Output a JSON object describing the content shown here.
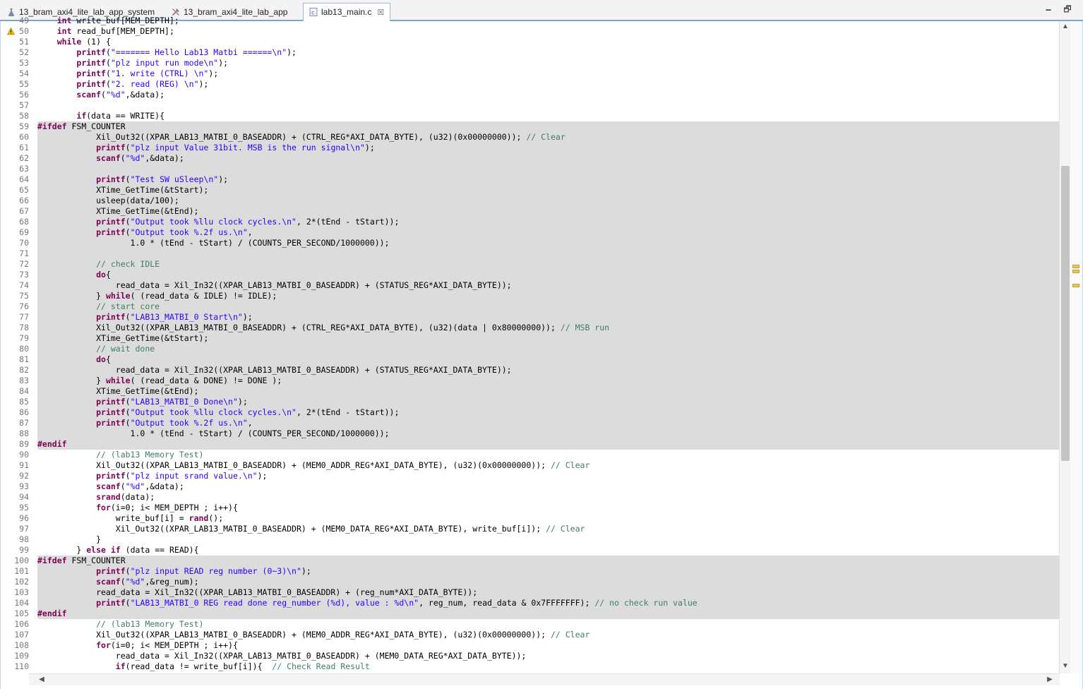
{
  "tabs": [
    {
      "label": "13_bram_axi4_lite_lab_app_system",
      "icon": "flask-icon"
    },
    {
      "label": "13_bram_axi4_lite_lab_app",
      "icon": "tools-icon"
    },
    {
      "label": "lab13_main.c",
      "icon": "c-file-icon",
      "active": true,
      "close": "☒"
    }
  ],
  "window_buttons": {
    "minimize": "🗕",
    "maximize": "🗗"
  },
  "code": {
    "highlighted_lines": [
      59,
      60,
      61,
      62,
      63,
      64,
      65,
      66,
      67,
      68,
      69,
      70,
      71,
      72,
      73,
      74,
      75,
      76,
      77,
      78,
      79,
      80,
      81,
      82,
      83,
      84,
      85,
      86,
      87,
      88,
      89,
      100,
      101,
      102,
      103,
      104,
      105
    ],
    "warning_line": 50,
    "lines": [
      {
        "n": "49",
        "t": "    int write_buf[MEM_DEPTH];"
      },
      {
        "n": "50",
        "t": "    int read_buf[MEM_DEPTH];"
      },
      {
        "n": "51",
        "t": "    while (1) {"
      },
      {
        "n": "52",
        "t": "        printf(\"======= Hello Lab13 Matbi ======\\n\");"
      },
      {
        "n": "53",
        "t": "        printf(\"plz input run mode\\n\");"
      },
      {
        "n": "54",
        "t": "        printf(\"1. write (CTRL) \\n\");"
      },
      {
        "n": "55",
        "t": "        printf(\"2. read (REG) \\n\");"
      },
      {
        "n": "56",
        "t": "        scanf(\"%d\",&data);"
      },
      {
        "n": "57",
        "t": ""
      },
      {
        "n": "58",
        "t": "        if(data == WRITE){"
      },
      {
        "n": "59",
        "t": "#ifdef FSM_COUNTER"
      },
      {
        "n": "60",
        "t": "            Xil_Out32((XPAR_LAB13_MATBI_0_BASEADDR) + (CTRL_REG*AXI_DATA_BYTE), (u32)(0x00000000)); // Clear"
      },
      {
        "n": "61",
        "t": "            printf(\"plz input Value 31bit. MSB is the run signal\\n\");"
      },
      {
        "n": "62",
        "t": "            scanf(\"%d\",&data);"
      },
      {
        "n": "63",
        "t": ""
      },
      {
        "n": "64",
        "t": "            printf(\"Test SW uSleep\\n\");"
      },
      {
        "n": "65",
        "t": "            XTime_GetTime(&tStart);"
      },
      {
        "n": "66",
        "t": "            usleep(data/100);"
      },
      {
        "n": "67",
        "t": "            XTime_GetTime(&tEnd);"
      },
      {
        "n": "68",
        "t": "            printf(\"Output took %llu clock cycles.\\n\", 2*(tEnd - tStart));"
      },
      {
        "n": "69",
        "t": "            printf(\"Output took %.2f us.\\n\","
      },
      {
        "n": "70",
        "t": "                   1.0 * (tEnd - tStart) / (COUNTS_PER_SECOND/1000000));"
      },
      {
        "n": "71",
        "t": ""
      },
      {
        "n": "72",
        "t": "            // check IDLE"
      },
      {
        "n": "73",
        "t": "            do{"
      },
      {
        "n": "74",
        "t": "                read_data = Xil_In32((XPAR_LAB13_MATBI_0_BASEADDR) + (STATUS_REG*AXI_DATA_BYTE));"
      },
      {
        "n": "75",
        "t": "            } while( (read_data & IDLE) != IDLE);"
      },
      {
        "n": "76",
        "t": "            // start core"
      },
      {
        "n": "77",
        "t": "            printf(\"LAB13_MATBI_0 Start\\n\");"
      },
      {
        "n": "78",
        "t": "            Xil_Out32((XPAR_LAB13_MATBI_0_BASEADDR) + (CTRL_REG*AXI_DATA_BYTE), (u32)(data | 0x80000000)); // MSB run"
      },
      {
        "n": "79",
        "t": "            XTime_GetTime(&tStart);"
      },
      {
        "n": "80",
        "t": "            // wait done"
      },
      {
        "n": "81",
        "t": "            do{"
      },
      {
        "n": "82",
        "t": "                read_data = Xil_In32((XPAR_LAB13_MATBI_0_BASEADDR) + (STATUS_REG*AXI_DATA_BYTE));"
      },
      {
        "n": "83",
        "t": "            } while( (read_data & DONE) != DONE );"
      },
      {
        "n": "84",
        "t": "            XTime_GetTime(&tEnd);"
      },
      {
        "n": "85",
        "t": "            printf(\"LAB13_MATBI_0 Done\\n\");"
      },
      {
        "n": "86",
        "t": "            printf(\"Output took %llu clock cycles.\\n\", 2*(tEnd - tStart));"
      },
      {
        "n": "87",
        "t": "            printf(\"Output took %.2f us.\\n\","
      },
      {
        "n": "88",
        "t": "                   1.0 * (tEnd - tStart) / (COUNTS_PER_SECOND/1000000));"
      },
      {
        "n": "89",
        "t": "#endif"
      },
      {
        "n": "90",
        "t": "            // (lab13 Memory Test)"
      },
      {
        "n": "91",
        "t": "            Xil_Out32((XPAR_LAB13_MATBI_0_BASEADDR) + (MEM0_ADDR_REG*AXI_DATA_BYTE), (u32)(0x00000000)); // Clear"
      },
      {
        "n": "92",
        "t": "            printf(\"plz input srand value.\\n\");"
      },
      {
        "n": "93",
        "t": "            scanf(\"%d\",&data);"
      },
      {
        "n": "94",
        "t": "            srand(data);"
      },
      {
        "n": "95",
        "t": "            for(i=0; i< MEM_DEPTH ; i++){"
      },
      {
        "n": "96",
        "t": "                write_buf[i] = rand();"
      },
      {
        "n": "97",
        "t": "                Xil_Out32((XPAR_LAB13_MATBI_0_BASEADDR) + (MEM0_DATA_REG*AXI_DATA_BYTE), write_buf[i]); // Clear"
      },
      {
        "n": "98",
        "t": "            }"
      },
      {
        "n": "99",
        "t": "        } else if (data == READ){"
      },
      {
        "n": "100",
        "t": "#ifdef FSM_COUNTER"
      },
      {
        "n": "101",
        "t": "            printf(\"plz input READ reg number (0~3)\\n\");"
      },
      {
        "n": "102",
        "t": "            scanf(\"%d\",&reg_num);"
      },
      {
        "n": "103",
        "t": "            read_data = Xil_In32((XPAR_LAB13_MATBI_0_BASEADDR) + (reg_num*AXI_DATA_BYTE));"
      },
      {
        "n": "104",
        "t": "            printf(\"LAB13_MATBI_0 REG read done reg_number (%d), value : %d\\n\", reg_num, read_data & 0x7FFFFFFF); // no check run value"
      },
      {
        "n": "105",
        "t": "#endif"
      },
      {
        "n": "106",
        "t": "            // (lab13 Memory Test)"
      },
      {
        "n": "107",
        "t": "            Xil_Out32((XPAR_LAB13_MATBI_0_BASEADDR) + (MEM0_ADDR_REG*AXI_DATA_BYTE), (u32)(0x00000000)); // Clear"
      },
      {
        "n": "108",
        "t": "            for(i=0; i< MEM_DEPTH ; i++){"
      },
      {
        "n": "109",
        "t": "                read_data = Xil_In32((XPAR_LAB13_MATBI_0_BASEADDR) + (MEM0_DATA_REG*AXI_DATA_BYTE));"
      },
      {
        "n": "110",
        "t": "                if(read_data != write_buf[i]){  // Check Read Result"
      }
    ]
  },
  "scroll": {
    "vertical_position": 0.4,
    "vertical_visible": 0.47
  }
}
